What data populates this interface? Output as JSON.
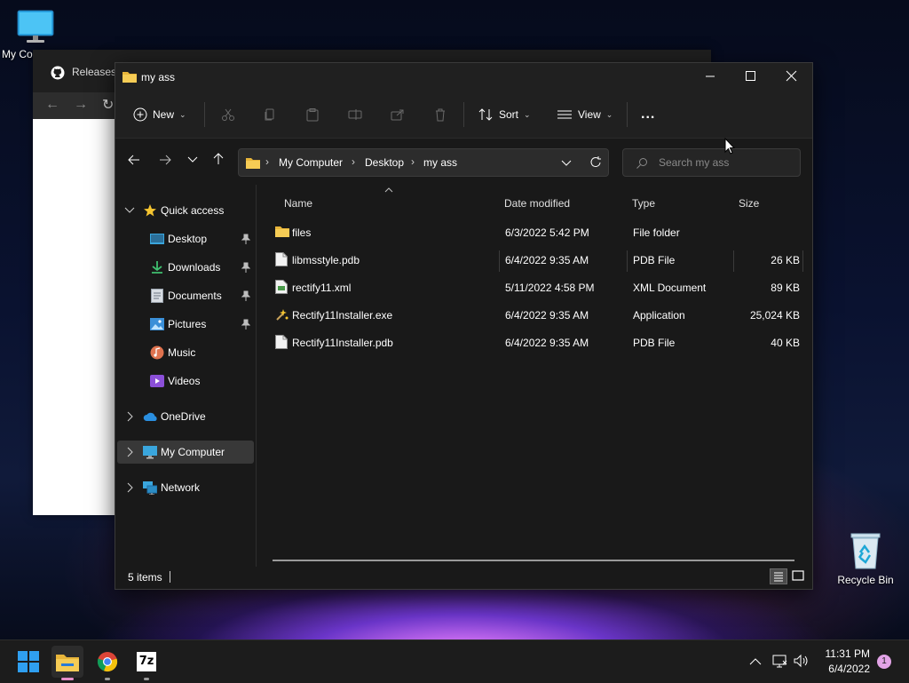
{
  "desktop": {
    "my_computer_label": "My Co",
    "recycle_bin_label": "Recycle Bin"
  },
  "browser": {
    "tab_title": "Releases"
  },
  "explorer": {
    "title": "my ass",
    "toolbar": {
      "new_label": "New",
      "sort_label": "Sort",
      "view_label": "View",
      "more_label": "..."
    },
    "address": {
      "crumbs": [
        "My Computer",
        "Desktop",
        "my ass"
      ]
    },
    "search": {
      "placeholder": "Search my ass"
    },
    "sidebar": {
      "quick_access": "Quick access",
      "items": [
        "Desktop",
        "Downloads",
        "Documents",
        "Pictures",
        "Music",
        "Videos"
      ],
      "onedrive": "OneDrive",
      "my_computer": "My Computer",
      "network": "Network"
    },
    "columns": {
      "name": "Name",
      "date": "Date modified",
      "type": "Type",
      "size": "Size"
    },
    "files": [
      {
        "name": "files",
        "date": "6/3/2022 5:42 PM",
        "type": "File folder",
        "size": "",
        "icon": "folder-icon"
      },
      {
        "name": "libmsstyle.pdb",
        "date": "6/4/2022 9:35 AM",
        "type": "PDB File",
        "size": "26 KB",
        "icon": "file-icon"
      },
      {
        "name": "rectify11.xml",
        "date": "5/11/2022 4:58 PM",
        "type": "XML Document",
        "size": "89 KB",
        "icon": "xml-file-icon"
      },
      {
        "name": "Rectify11Installer.exe",
        "date": "6/4/2022 9:35 AM",
        "type": "Application",
        "size": "25,024 KB",
        "icon": "exe-icon"
      },
      {
        "name": "Rectify11Installer.pdb",
        "date": "6/4/2022 9:35 AM",
        "type": "PDB File",
        "size": "40 KB",
        "icon": "file-icon"
      }
    ],
    "status": {
      "items_count": "5 items"
    }
  },
  "taskbar": {
    "time": "11:31 PM",
    "date": "6/4/2022",
    "notification_count": "1",
    "sevenzip_label": "7z"
  }
}
